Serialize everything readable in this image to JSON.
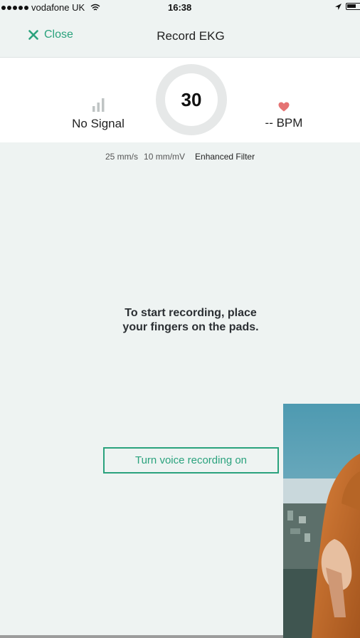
{
  "status_bar": {
    "carrier": "vodafone UK",
    "time": "16:38"
  },
  "nav": {
    "close_label": "Close",
    "title": "Record EKG"
  },
  "stats": {
    "signal_label": "No Signal",
    "countdown": "30",
    "bpm_label": "-- BPM"
  },
  "settings": {
    "speed": "25 mm/s",
    "gain": "10 mm/mV",
    "filter": "Enhanced Filter"
  },
  "instructions": {
    "line1": "To start recording, place",
    "line2": "your fingers on the pads."
  },
  "voice_button": {
    "label": "Turn voice recording on"
  },
  "colors": {
    "accent": "#2aa27d",
    "heart": "#e57373",
    "background": "#eef3f2"
  },
  "icons": {
    "close": "close-icon",
    "signal": "signal-bars-icon",
    "heart": "heart-icon",
    "wifi": "wifi-icon",
    "battery": "battery-icon",
    "location": "location-arrow-icon"
  }
}
